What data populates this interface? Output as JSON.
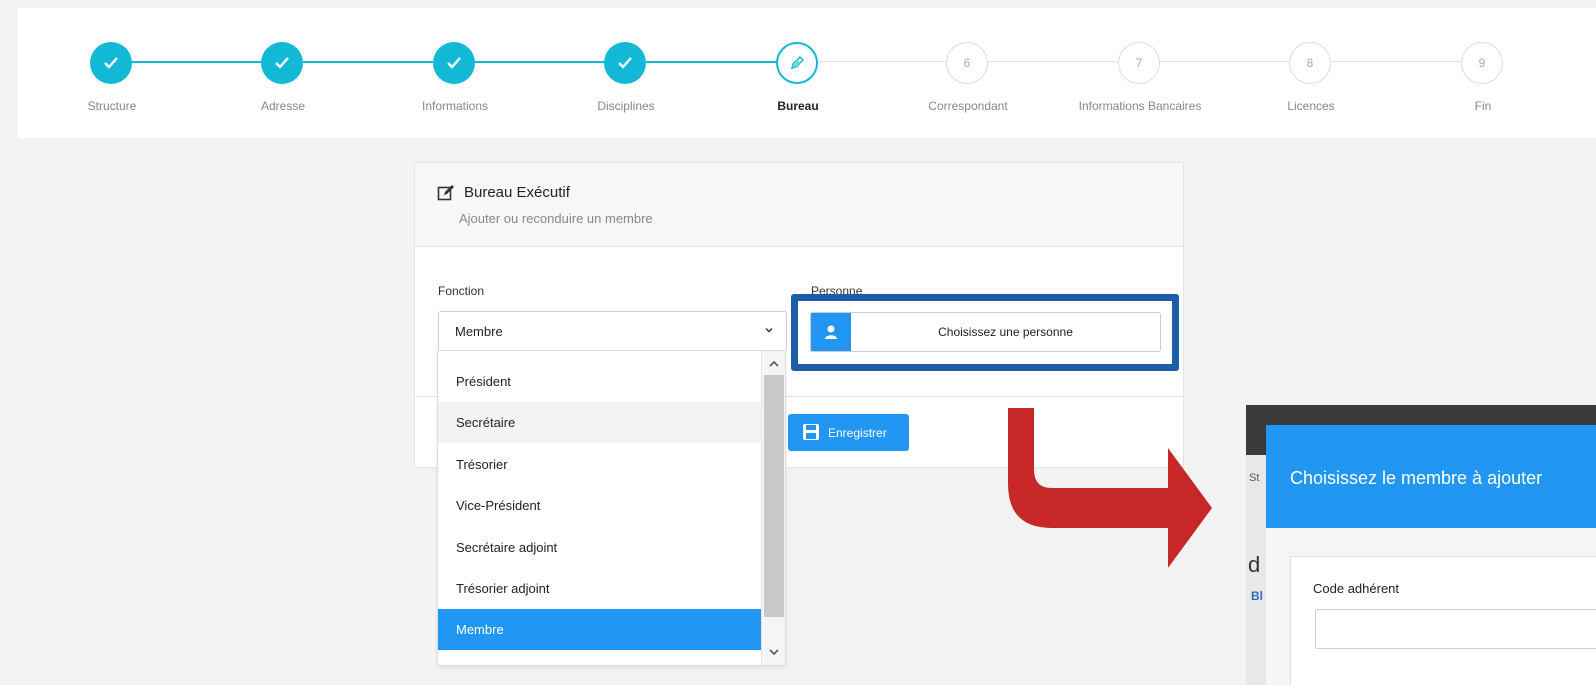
{
  "stepper": {
    "steps": [
      {
        "label": "Structure",
        "state": "done",
        "marker": "check-icon"
      },
      {
        "label": "Adresse",
        "state": "done",
        "marker": "check-icon"
      },
      {
        "label": "Informations",
        "state": "done",
        "marker": "check-icon"
      },
      {
        "label": "Disciplines",
        "state": "done",
        "marker": "check-icon"
      },
      {
        "label": "Bureau",
        "state": "active",
        "marker": "pencil-icon"
      },
      {
        "label": "Correspondant",
        "state": "todo",
        "number": "6"
      },
      {
        "label": "Informations Bancaires",
        "state": "todo",
        "number": "7"
      },
      {
        "label": "Licences",
        "state": "todo",
        "number": "8"
      },
      {
        "label": "Fin",
        "state": "todo",
        "number": "9"
      }
    ]
  },
  "card": {
    "title": "Bureau Exécutif",
    "subtitle": "Ajouter ou reconduire un membre",
    "fonction_label": "Fonction",
    "fonction_value": "Membre",
    "personne_label": "Personne",
    "person_button_label": "Choisissez une personne",
    "save_label": "Enregistrer"
  },
  "dropdown": {
    "options": [
      "Président",
      "Secrétaire",
      "Trésorier",
      "Vice-Président",
      "Secrétaire adjoint",
      "Trésorier adjoint",
      "Membre"
    ],
    "hovered": "Secrétaire",
    "selected": "Membre"
  },
  "modal": {
    "title": "Choisissez le membre à ajouter",
    "code_label": "Code adhérent",
    "code_value": "",
    "background_fragments": [
      "St",
      "d",
      "Bl"
    ]
  },
  "colors": {
    "accent": "#2196f3",
    "step_done": "#12b8d6",
    "highlight": "#1e5ea8",
    "arrow": "#c62828"
  }
}
